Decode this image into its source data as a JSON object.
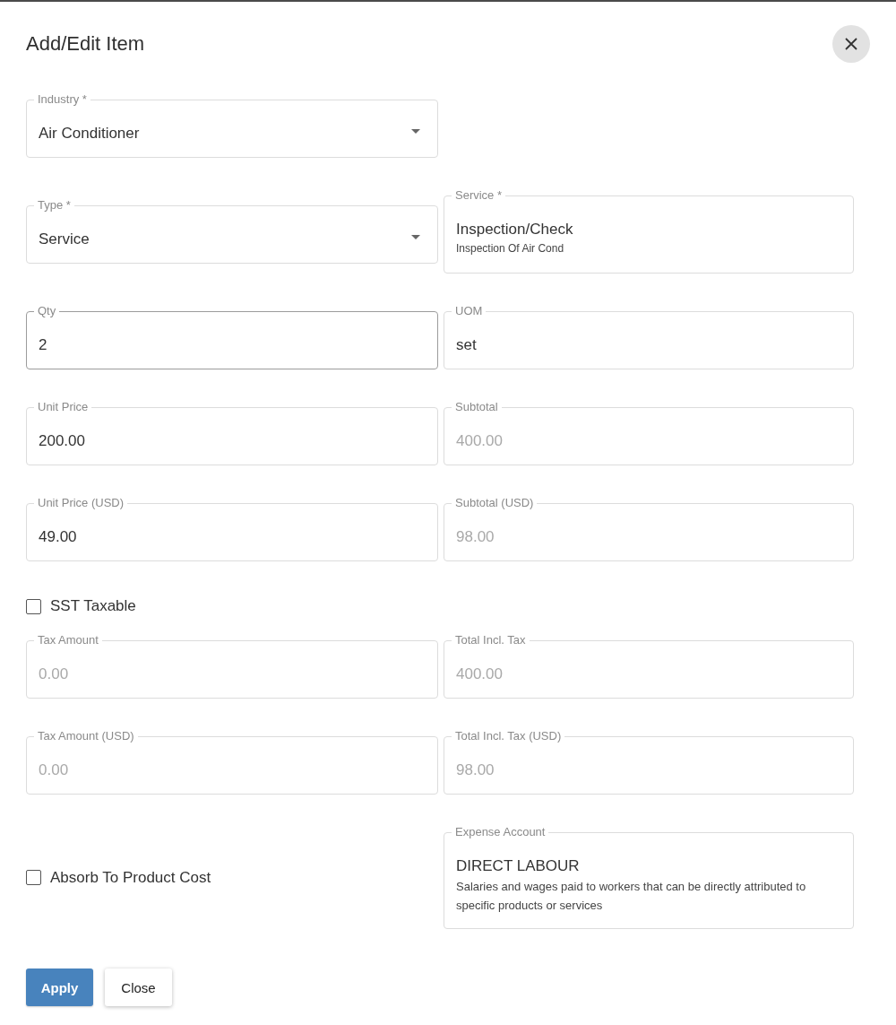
{
  "dialog": {
    "title": "Add/Edit Item",
    "rows": [
      {
        "fields": [
          {
            "kind": "select",
            "label": "Industry *",
            "value": "Air Conditioner",
            "disabled": false,
            "active": false
          }
        ]
      },
      {
        "fields": [
          {
            "kind": "select",
            "label": "Type *",
            "value": "Service",
            "disabled": false,
            "active": false
          },
          {
            "kind": "lookup",
            "label": "Service *",
            "value": "Inspection/Check",
            "detail": "Inspection Of Air Cond",
            "disabled": false,
            "active": false
          }
        ]
      },
      {
        "fields": [
          {
            "kind": "text",
            "label": "Qty",
            "value": "2",
            "disabled": false,
            "active": true
          },
          {
            "kind": "text",
            "label": "UOM",
            "value": "set",
            "disabled": false,
            "active": false
          }
        ]
      },
      {
        "fields": [
          {
            "kind": "text",
            "label": "Unit Price",
            "value": "200.00",
            "disabled": false,
            "active": false
          },
          {
            "kind": "text",
            "label": "Subtotal",
            "value": "400.00",
            "disabled": true,
            "active": false
          }
        ]
      },
      {
        "fields": [
          {
            "kind": "text",
            "label": "Unit Price (USD)",
            "value": "49.00",
            "disabled": false,
            "active": false
          },
          {
            "kind": "text",
            "label": "Subtotal (USD)",
            "value": "98.00",
            "disabled": true,
            "active": false
          }
        ]
      },
      {
        "fields": [
          {
            "kind": "checkbox",
            "label": "SST Taxable",
            "checked": false
          }
        ]
      },
      {
        "fields": [
          {
            "kind": "text",
            "label": "Tax Amount",
            "value": "0.00",
            "disabled": true,
            "active": false
          },
          {
            "kind": "text",
            "label": "Total Incl. Tax",
            "value": "400.00",
            "disabled": true,
            "active": false
          }
        ]
      },
      {
        "fields": [
          {
            "kind": "text",
            "label": "Tax Amount (USD)",
            "value": "0.00",
            "disabled": true,
            "active": false
          },
          {
            "kind": "text",
            "label": "Total Incl. Tax (USD)",
            "value": "98.00",
            "disabled": true,
            "active": false
          }
        ]
      },
      {
        "fields": [
          {
            "kind": "checkbox",
            "label": "Absorb To Product Cost",
            "checked": false
          },
          {
            "kind": "lookup",
            "label": "Expense Account",
            "value": "DIRECT LABOUR",
            "detail": "Salaries and wages paid to workers that can be directly attributed to specific products or services",
            "disabled": false,
            "active": false
          }
        ]
      }
    ],
    "buttons": [
      {
        "kind": "primary",
        "label": "Apply"
      },
      {
        "kind": "secondary",
        "label": "Close"
      }
    ]
  }
}
